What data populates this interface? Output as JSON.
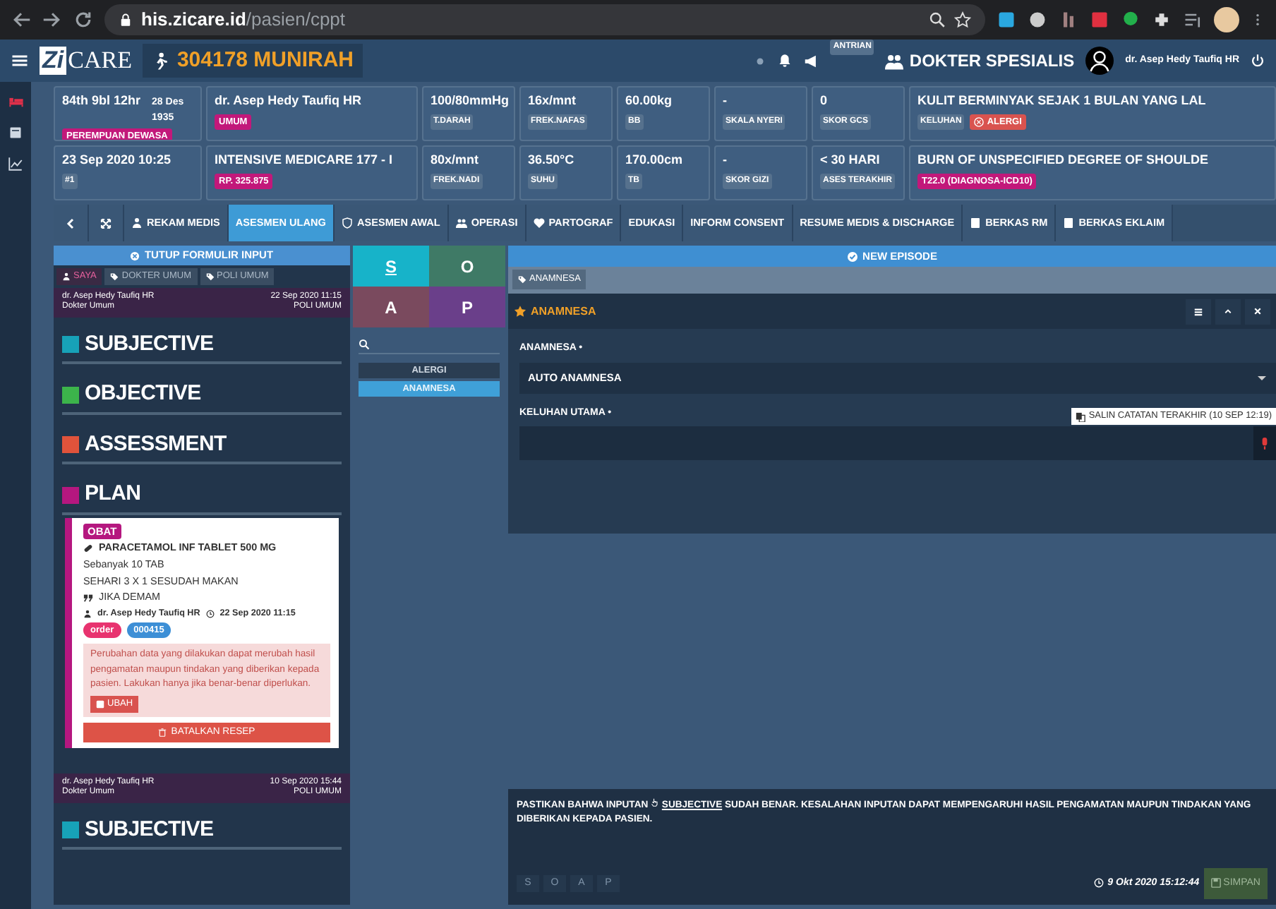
{
  "browser": {
    "url_host": "his.zicare.id",
    "url_path": "/pasien/cppt"
  },
  "app_bar": {
    "logo_mark": "Zi",
    "logo_word": "CARE",
    "patient": "304178  MUNIRAH",
    "queue": "ANTRIAN",
    "role": "DOKTER SPESIALIS",
    "user": "dr. Asep Hedy Taufiq HR"
  },
  "info_rows": [
    [
      {
        "value": "84th 9bl 12hr",
        "note": "28 Des 1935",
        "badges": [
          {
            "text": "PEREMPUAN DEWASA",
            "color": "#c2187a"
          }
        ]
      },
      {
        "value": "dr. Asep Hedy Taufiq HR",
        "badges": [
          {
            "text": "UMUM",
            "color": "#c2187a"
          }
        ]
      },
      {
        "value": "100/80mmHg",
        "label": "T.DARAH"
      },
      {
        "value": "16x/mnt",
        "label": "FREK.NAFAS"
      },
      {
        "value": "60.00kg",
        "label": "BB"
      },
      {
        "value": "-",
        "label": "SKALA NYERI"
      },
      {
        "value": "0",
        "label": "SKOR GCS"
      },
      {
        "value": "KULIT BERMINYAK SEJAK 1 BULAN YANG LAL",
        "label": "KELUHAN",
        "badges": [
          {
            "text": "ALERGI",
            "color": "#d9534f",
            "kind": "alert"
          }
        ]
      }
    ],
    [
      {
        "value": "23 Sep 2020 10:25",
        "label": "#1"
      },
      {
        "value": "INTENSIVE MEDICARE 177 - I",
        "badges": [
          {
            "text": "RP. 325.875",
            "color": "#c2187a"
          }
        ]
      },
      {
        "value": "80x/mnt",
        "label": "FREK.NADI"
      },
      {
        "value": "36.50°C",
        "label": "SUHU"
      },
      {
        "value": "170.00cm",
        "label": "TB"
      },
      {
        "value": "-",
        "label": "SKOR GIZI"
      },
      {
        "value": "< 30 HARI",
        "label": "ASES TERAKHIR"
      },
      {
        "value": "BURN OF UNSPECIFIED DEGREE OF SHOULDE",
        "badges": [
          {
            "text": "T22.0 (DIAGNOSA-ICD10)",
            "color": "#c2187a"
          }
        ]
      }
    ]
  ],
  "tabs": [
    {
      "label": "REKAM MEDIS",
      "selected": false
    },
    {
      "label": "ASESMEN ULANG",
      "selected": true
    },
    {
      "label": "ASESMEN AWAL",
      "selected": false
    },
    {
      "label": "OPERASI",
      "selected": false
    },
    {
      "label": "PARTOGRAF",
      "selected": false
    },
    {
      "label": "EDUKASI",
      "selected": false
    },
    {
      "label": "INFORM CONSENT",
      "selected": false
    },
    {
      "label": "RESUME MEDIS & DISCHARGE",
      "selected": false
    },
    {
      "label": "BERKAS RM",
      "selected": false
    },
    {
      "label": "BERKAS EKLAIM",
      "selected": false
    }
  ],
  "input_panel": {
    "close_button": "TUTUP FORMULIR INPUT",
    "filters": [
      {
        "label": "SAYA",
        "selected": true
      },
      {
        "label": "DOKTER UMUM",
        "selected": false
      },
      {
        "label": "POLI UMUM",
        "selected": false
      }
    ],
    "entries": [
      {
        "doctor": "dr. Asep Hedy Taufiq HR",
        "role": "Dokter Umum",
        "time": "22 Sep 2020 11:15",
        "clinic": "POLI UMUM",
        "sections": [
          {
            "title": "SUBJECTIVE",
            "color": "#17a2b8"
          },
          {
            "title": "OBJECTIVE",
            "color": "#3cb44b"
          },
          {
            "title": "ASSESSMENT",
            "color": "#e0533b"
          },
          {
            "title": "PLAN",
            "color": "#b5177f",
            "items": [
              {
                "tag": "OBAT",
                "drug": "PARACETAMOL INF TABLET 500 MG",
                "lines": [
                  "Sebanyak 10 TAB",
                  "SEHARI 3 X 1  SESUDAH MAKAN"
                ],
                "note": "JIKA DEMAM",
                "author": "dr. Asep Hedy Taufiq HR",
                "time": "22 Sep 2020 11:15",
                "badges": [
                  {
                    "text": "order",
                    "color": "#e8336f"
                  },
                  {
                    "text": "000415",
                    "color": "#3d8fd6"
                  }
                ],
                "warning": "Perubahan data yang dilakukan dapat merubah hasil pengamatan maupun tindakan yang diberikan kepada pasien. Lakukan hanya jika benar-benar diperlukan.",
                "edit_button": "UBAH",
                "cancel_button": "BATALKAN RESEP"
              }
            ]
          }
        ]
      },
      {
        "doctor": "dr. Asep Hedy Taufiq HR",
        "role": "Dokter Umum",
        "time": "10 Sep 2020 15:44",
        "clinic": "POLI UMUM",
        "sections": [
          {
            "title": "SUBJECTIVE",
            "color": "#17a2b8"
          }
        ]
      }
    ]
  },
  "soap": {
    "tiles": [
      {
        "label": "S",
        "selected": true,
        "color": "#17b3c9"
      },
      {
        "label": "O",
        "selected": false,
        "color": "#3f7a66"
      },
      {
        "label": "A",
        "selected": false,
        "color": "#7a4a5e"
      },
      {
        "label": "P",
        "selected": false,
        "color": "#6a3f8a"
      }
    ],
    "items": [
      {
        "label": "ALERGI",
        "selected": false
      },
      {
        "label": "ANAMNESA",
        "selected": true
      }
    ]
  },
  "form": {
    "episode_button": "NEW EPISODE",
    "breadcrumb": "ANAMNESA",
    "title": "ANAMNESA",
    "fields": [
      {
        "kind": "select",
        "label": "ANAMNESA •",
        "value": "AUTO ANAMNESA"
      },
      {
        "kind": "textarea",
        "label": "KELUHAN UTAMA •",
        "copy_button": "SALIN CATATAN TERAKHIR (10 SEP 12:19)"
      }
    ]
  },
  "footer": {
    "notice_before": "PASTIKAN BAHWA INPUTAN",
    "notice_link": "SUBJECTIVE",
    "notice_after": "SUDAH BENAR. KESALAHAN INPUTAN DAPAT MEMPENGARUHI HASIL PENGAMATAN MAUPUN TINDAKAN YANG DIBERIKAN KEPADA PASIEN.",
    "soap_keys": [
      {
        "label": "S",
        "disabled": true
      },
      {
        "label": "O",
        "disabled": true
      },
      {
        "label": "A",
        "disabled": true
      },
      {
        "label": "P",
        "disabled": true
      }
    ],
    "timestamp": "9 Okt 2020 15:12:44",
    "save_button": "SIMPAN"
  }
}
